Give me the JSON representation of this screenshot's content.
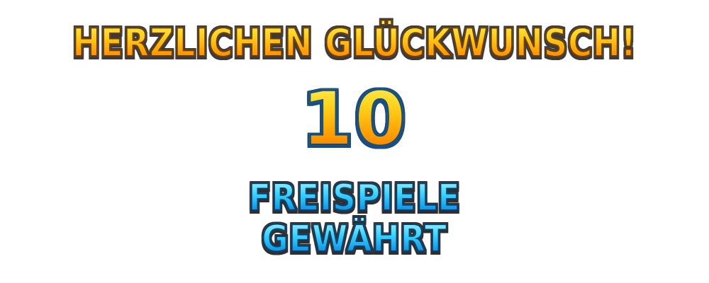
{
  "popup": {
    "headline": "HERZLICHEN GLÜCKWUNSCH!",
    "free_spins_count": "10",
    "award_line_1": "FREISPIELE",
    "award_line_2": "GEWÄHRT"
  },
  "colors": {
    "gold_top": "#fff36a",
    "gold_bottom": "#e86b00",
    "blue_top": "#b6f6ff",
    "blue_bottom": "#0a6fc9",
    "outline_dark": "#3b3b3b",
    "number_outline": "#1a4d85",
    "background": "#ffffff"
  }
}
